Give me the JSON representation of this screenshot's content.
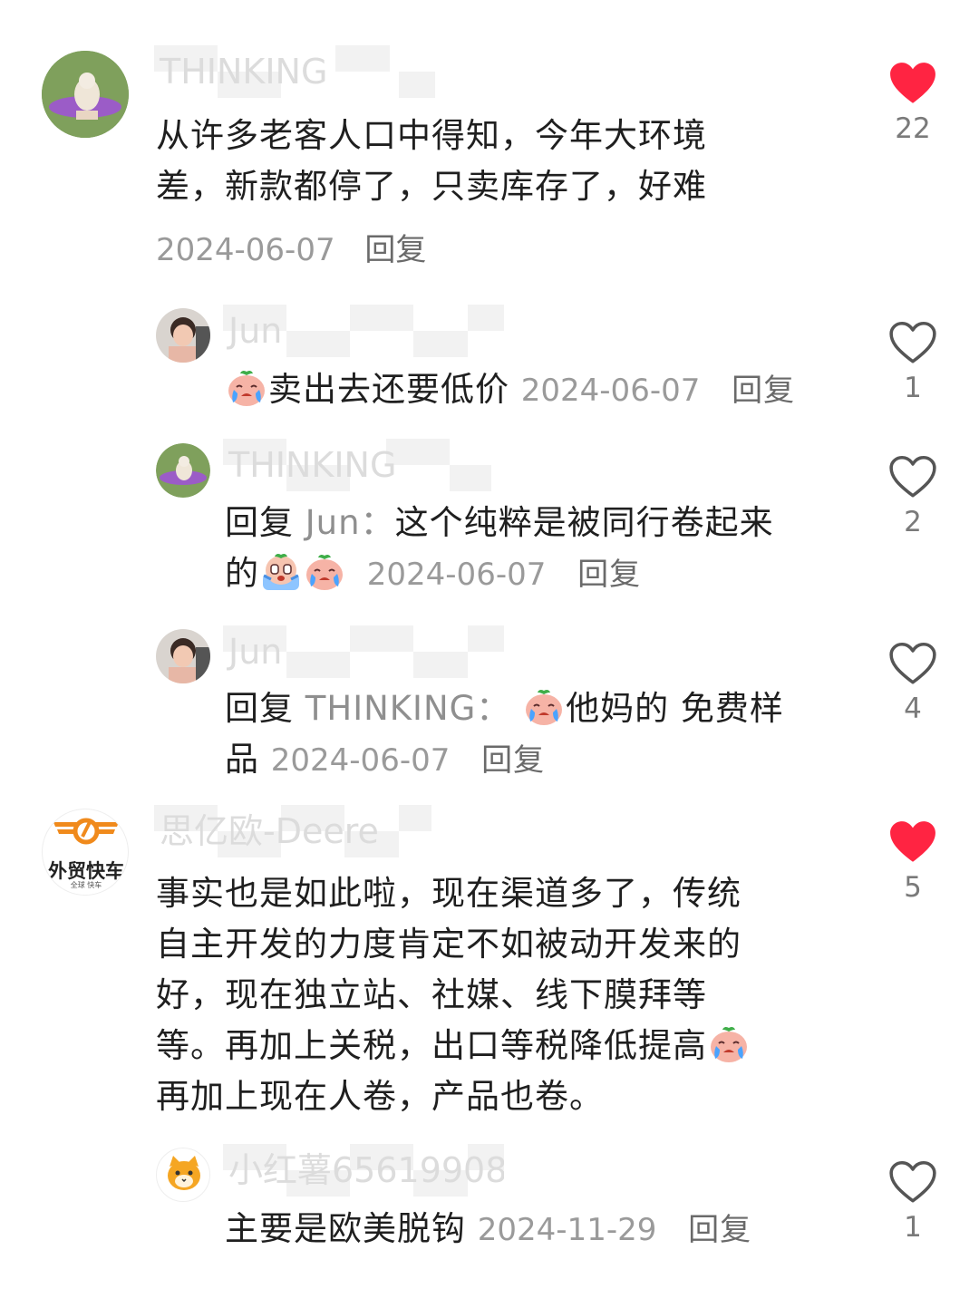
{
  "comments": [
    {
      "user": "THINKING",
      "text_lines": [
        "从许多老客人口中得知，今年大环境",
        "差，新款都停了，只卖库存了，好难"
      ],
      "date": "2024-06-07",
      "reply_label": "回复",
      "likes": "22",
      "liked": true,
      "replies": [
        {
          "user": "Jun",
          "emoji_name": "crying-face-emoji",
          "text": "卖出去还要低价",
          "date": "2024-06-07",
          "reply_label": "回复",
          "likes": "1",
          "liked": false
        },
        {
          "user": "THINKING",
          "prefix": "回复",
          "mention": "Jun：",
          "text_line1": "这个纯粹是被同行卷起来",
          "text_line2": "的",
          "emoji_names": [
            "screaming-face-emoji",
            "crying-face-emoji"
          ],
          "date": "2024-06-07",
          "reply_label": "回复",
          "likes": "2",
          "liked": false
        },
        {
          "user": "Jun",
          "prefix": "回复",
          "mention": "THINKING：",
          "emoji_name": "crying-face-emoji",
          "text_line1": "他妈的 免费样",
          "text_line2": "品",
          "date": "2024-06-07",
          "reply_label": "回复",
          "likes": "4",
          "liked": false
        }
      ]
    },
    {
      "user": "思亿欧-Deere",
      "avatar_text": "外贸快车",
      "avatar_subtext": "全球 快车",
      "text_lines": [
        "事实也是如此啦，现在渠道多了，传统",
        "自主开发的力度肯定不如被动开发来的",
        "好，现在独立站、社媒、线下膜拜等",
        "等。再加上关税，出口等税降低提高",
        "再加上现在人卷，产品也卷。"
      ],
      "emoji_name": "crying-face-emoji",
      "likes": "5",
      "liked": true,
      "replies": [
        {
          "user": "小红薯65619908",
          "text": "主要是欧美脱钩",
          "date": "2024-11-29",
          "reply_label": "回复",
          "likes": "1",
          "liked": false
        }
      ]
    }
  ],
  "colors": {
    "like_active": "#ff2442",
    "like_outline": "#555555",
    "date": "#9a9a9a"
  }
}
